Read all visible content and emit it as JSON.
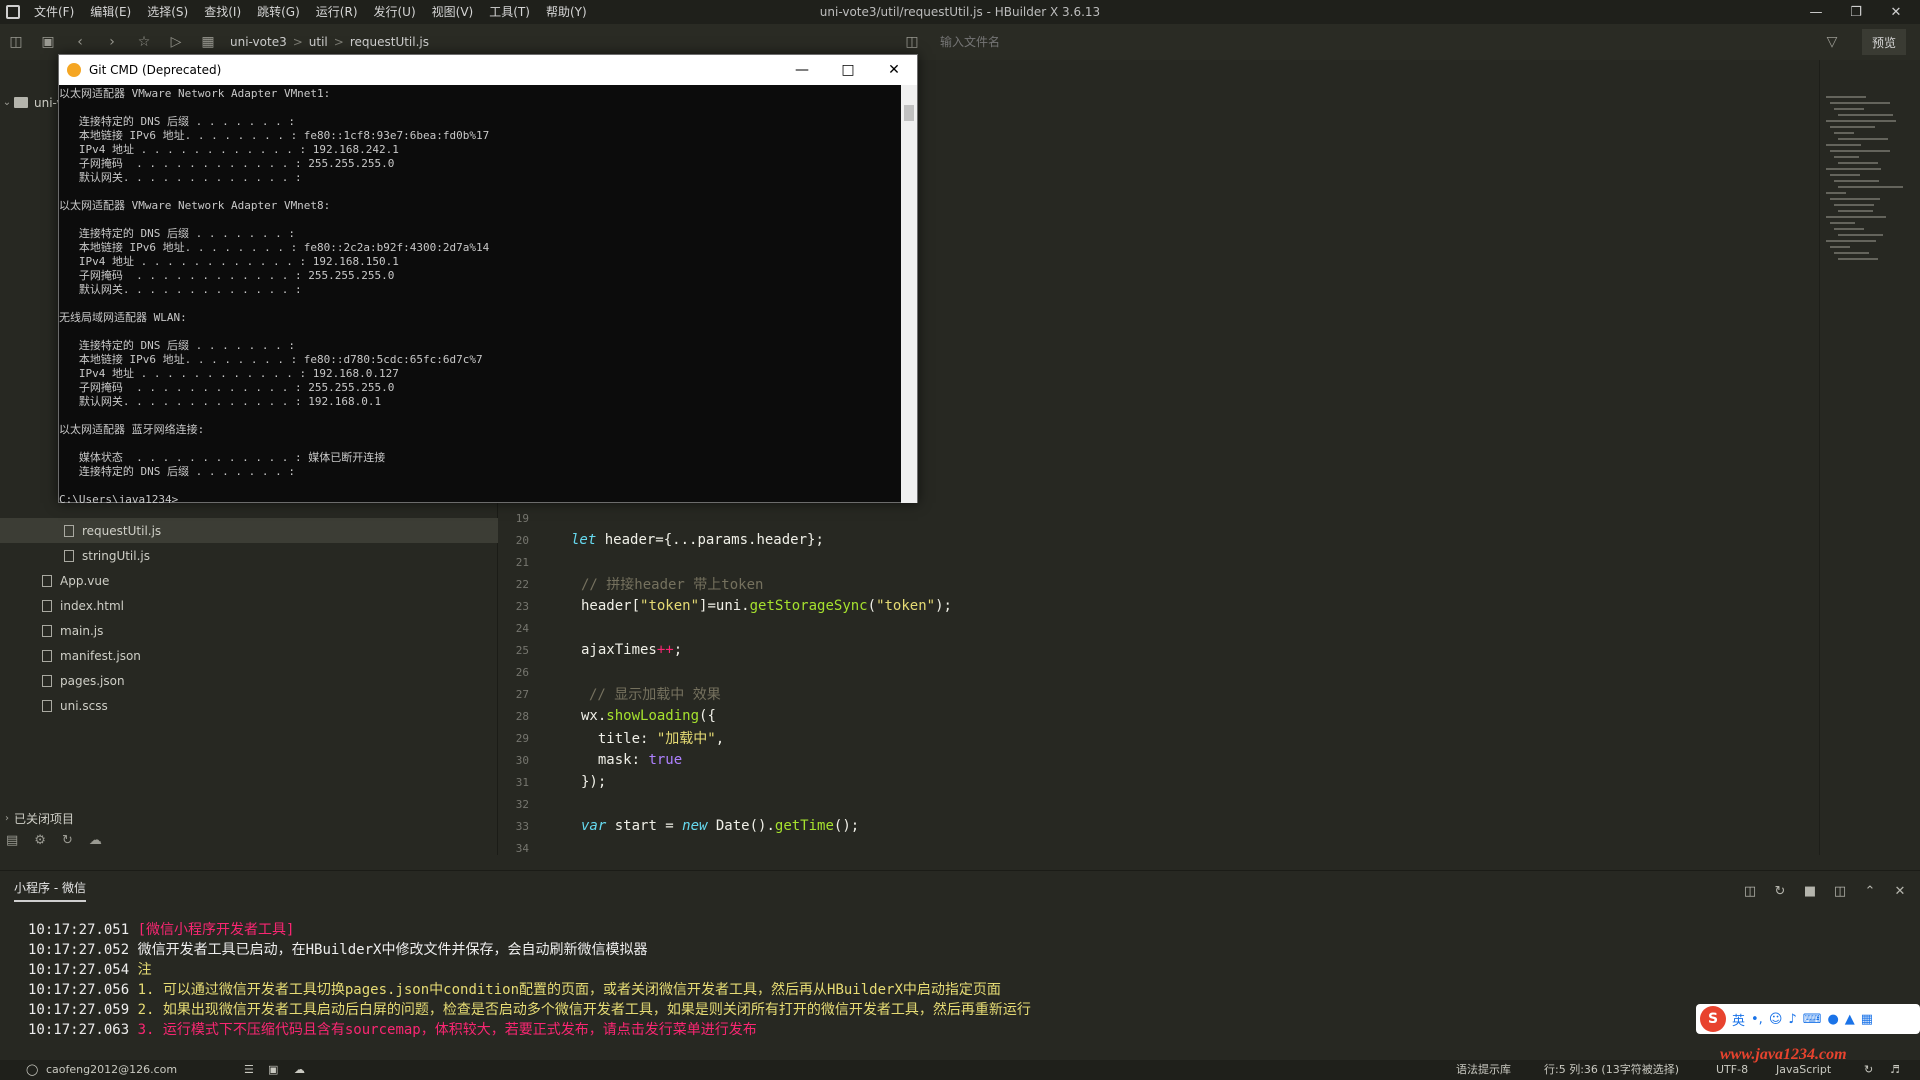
{
  "menubar": {
    "items": [
      "文件(F)",
      "编辑(E)",
      "选择(S)",
      "查找(I)",
      "跳转(G)",
      "运行(R)",
      "发行(U)",
      "视图(V)",
      "工具(T)",
      "帮助(Y)"
    ],
    "window_title": "uni-vote3/util/requestUtil.js - HBuilder X 3.6.13"
  },
  "toolbar": {
    "breadcrumb": [
      "uni-vote3",
      "util",
      "requestUtil.js"
    ],
    "search_placeholder": "输入文件名",
    "preview_label": "预览"
  },
  "cmd": {
    "title": "Git CMD (Deprecated)",
    "lines": [
      "以太网适配器 VMware Network Adapter VMnet1:",
      "",
      "   连接特定的 DNS 后缀 . . . . . . . :",
      "   本地链接 IPv6 地址. . . . . . . . : fe80::1cf8:93e7:6bea:fd0b%17",
      "   IPv4 地址 . . . . . . . . . . . . : 192.168.242.1",
      "   子网掩码  . . . . . . . . . . . . : 255.255.255.0",
      "   默认网关. . . . . . . . . . . . . :",
      "",
      "以太网适配器 VMware Network Adapter VMnet8:",
      "",
      "   连接特定的 DNS 后缀 . . . . . . . :",
      "   本地链接 IPv6 地址. . . . . . . . : fe80::2c2a:b92f:4300:2d7a%14",
      "   IPv4 地址 . . . . . . . . . . . . : 192.168.150.1",
      "   子网掩码  . . . . . . . . . . . . : 255.255.255.0",
      "   默认网关. . . . . . . . . . . . . :",
      "",
      "无线局域网适配器 WLAN:",
      "",
      "   连接特定的 DNS 后缀 . . . . . . . :",
      "   本地链接 IPv6 地址. . . . . . . . : fe80::d780:5cdc:65fc:6d7c%7",
      "   IPv4 地址 . . . . . . . . . . . . : 192.168.0.127",
      "   子网掩码  . . . . . . . . . . . . : 255.255.255.0",
      "   默认网关. . . . . . . . . . . . . : 192.168.0.1",
      "",
      "以太网适配器 蓝牙网络连接:",
      "",
      "   媒体状态  . . . . . . . . . . . . : 媒体已断开连接",
      "   连接特定的 DNS 后缀 . . . . . . . :",
      "",
      "C:\\Users\\java1234>"
    ]
  },
  "sidebar": {
    "project": "uni-vote3",
    "files": [
      {
        "name": "requestUtil.js",
        "selected": true
      },
      {
        "name": "stringUtil.js",
        "selected": false
      },
      {
        "name": "App.vue",
        "selected": false
      },
      {
        "name": "index.html",
        "selected": false
      },
      {
        "name": "main.js",
        "selected": false
      },
      {
        "name": "manifest.json",
        "selected": false
      },
      {
        "name": "pages.json",
        "selected": false
      },
      {
        "name": "uni.scss",
        "selected": false
      }
    ],
    "closed_projects": "已关闭项目"
  },
  "editor": {
    "lines": [
      {
        "n": "19",
        "text": ""
      },
      {
        "n": "20",
        "text": "let header={...params.header};"
      },
      {
        "n": "21",
        "text": ""
      },
      {
        "n": "22",
        "text": "// 拼接header 带上token"
      },
      {
        "n": "23",
        "text": "header[\"token\"]=uni.getStorageSync(\"token\");"
      },
      {
        "n": "24",
        "text": ""
      },
      {
        "n": "25",
        "text": "ajaxTimes++;"
      },
      {
        "n": "26",
        "text": ""
      },
      {
        "n": "27",
        "text": "// 显示加载中 效果"
      },
      {
        "n": "28",
        "text": "wx.showLoading({"
      },
      {
        "n": "29",
        "text": "  title: \"加载中\","
      },
      {
        "n": "30",
        "text": "  mask: true"
      },
      {
        "n": "31",
        "text": "});"
      },
      {
        "n": "32",
        "text": ""
      },
      {
        "n": "33",
        "text": "var start = new Date().getTime();"
      },
      {
        "n": "34",
        "text": ""
      }
    ]
  },
  "console": {
    "tab": "小程序 - 微信",
    "lines": [
      {
        "time": "10:17:27.051",
        "text": "[微信小程序开发者工具]",
        "color": "#f92672"
      },
      {
        "time": "10:17:27.052",
        "text": "微信开发者工具已启动，在HBuilderX中修改文件并保存，会自动刷新微信模拟器",
        "color": "#ededed"
      },
      {
        "time": "10:17:27.054",
        "text": "注",
        "color": "#e6db74"
      },
      {
        "time": "10:17:27.056",
        "text": "1. 可以通过微信开发者工具切换pages.json中condition配置的页面，或者关闭微信开发者工具，然后再从HBuilderX中启动指定页面",
        "color": "#e6db74"
      },
      {
        "time": "10:17:27.059",
        "text": "2. 如果出现微信开发者工具启动后白屏的问题，检查是否启动多个微信开发者工具，如果是则关闭所有打开的微信开发者工具，然后再重新运行",
        "color": "#e6db74"
      },
      {
        "time": "10:17:27.063",
        "text": "3. 运行模式下不压缩代码且含有sourcemap，体积较大，若要正式发布，请点击发行菜单进行发布",
        "color": "#f92672"
      }
    ]
  },
  "statusbar": {
    "user": "caofeng2012@126.com",
    "hint": "语法提示库",
    "position": "行:5  列:36 (13字符被选择)",
    "encoding": "UTF-8",
    "language": "JavaScript"
  },
  "ime": {
    "logo": "S",
    "mode": "英"
  },
  "watermark": "www.java1234.com"
}
